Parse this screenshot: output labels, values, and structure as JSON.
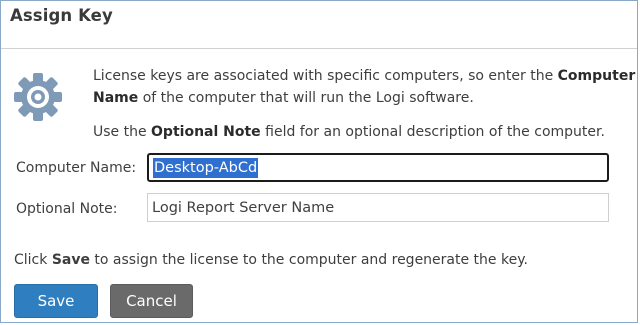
{
  "dialog": {
    "title": "Assign Key"
  },
  "icons": {
    "gear": "gear-icon"
  },
  "info": {
    "p1_text1": "License keys are associated with specific computers, so enter the ",
    "p1_bold": "Computer Name",
    "p1_text2": " of the computer that will run the Logi software.",
    "p2_text1": "Use the ",
    "p2_bold": "Optional Note",
    "p2_text2": " field for an optional description of the computer."
  },
  "form": {
    "computer_name_label": "Computer Name:",
    "computer_name_value": "Desktop-AbCd",
    "optional_note_label": "Optional Note:",
    "optional_note_value": "Logi Report Server Name"
  },
  "footer": {
    "text1": "Click ",
    "bold": "Save",
    "text2": " to assign the license to the computer and regenerate the key."
  },
  "buttons": {
    "save_label": "Save",
    "cancel_label": "Cancel"
  },
  "colors": {
    "save_button": "#2f7fc0",
    "cancel_button": "#6a6a6a",
    "selection": "#2f6fd0",
    "gear_icon": "#7f9ab6"
  }
}
